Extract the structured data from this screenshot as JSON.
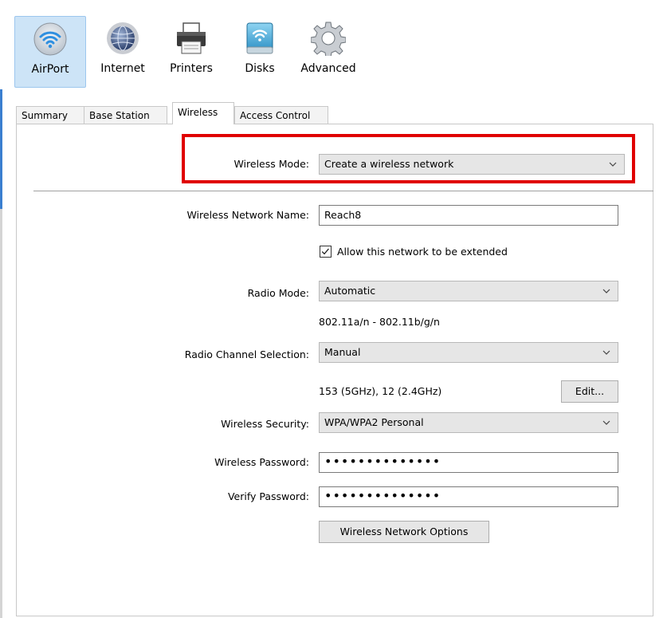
{
  "toolbar": {
    "items": [
      {
        "label": "AirPort",
        "icon": "airport-wifi-icon",
        "selected": true
      },
      {
        "label": "Internet",
        "icon": "globe-icon",
        "selected": false
      },
      {
        "label": "Printers",
        "icon": "printer-icon",
        "selected": false
      },
      {
        "label": "Disks",
        "icon": "disk-icon",
        "selected": false
      },
      {
        "label": "Advanced",
        "icon": "gear-icon",
        "selected": false
      }
    ]
  },
  "tabs": [
    {
      "label": "Summary",
      "active": false
    },
    {
      "label": "Base Station",
      "active": false
    },
    {
      "label": "Wireless",
      "active": true
    },
    {
      "label": "Access Control",
      "active": false
    }
  ],
  "form": {
    "wireless_mode": {
      "label": "Wireless Mode:",
      "value": "Create a wireless network"
    },
    "network_name": {
      "label": "Wireless Network Name:",
      "value": "Reach8"
    },
    "allow_extend": {
      "label": "Allow this network to be extended",
      "checked": true
    },
    "radio_mode": {
      "label": "Radio Mode:",
      "value": "Automatic",
      "info": "802.11a/n - 802.11b/g/n"
    },
    "channel": {
      "label": "Radio Channel Selection:",
      "value": "Manual",
      "info": "153 (5GHz), 12 (2.4GHz)",
      "edit_label": "Edit..."
    },
    "security": {
      "label": "Wireless Security:",
      "value": "WPA/WPA2 Personal"
    },
    "password": {
      "label": "Wireless Password:",
      "value": "••••••••••••••"
    },
    "verify": {
      "label": "Verify Password:",
      "value": "••••••••••••••"
    },
    "options_label": "Wireless Network Options"
  },
  "colors": {
    "highlight": "#e00000",
    "selected_tool": "#cde4f7"
  }
}
